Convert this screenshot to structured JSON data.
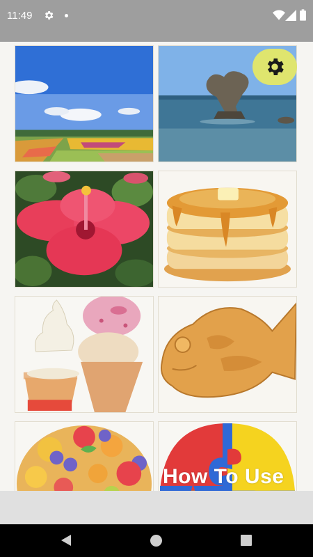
{
  "status_bar": {
    "time": "11:49",
    "icons": [
      "gear-icon",
      "notification-dot-icon",
      "wifi-icon",
      "cell-signal-icon",
      "battery-icon"
    ]
  },
  "settings_button": {
    "icon": "gear-icon"
  },
  "gallery": {
    "tiles": [
      {
        "name": "flower-field-photo"
      },
      {
        "name": "heart-rock-photo"
      },
      {
        "name": "hibiscus-photo"
      },
      {
        "name": "pancakes-illustration"
      },
      {
        "name": "ice-cream-illustration"
      },
      {
        "name": "taiyaki-illustration"
      },
      {
        "name": "fruit-tart-illustration"
      },
      {
        "name": "puzzle-how-to-use",
        "label": "How To Use"
      }
    ]
  },
  "nav_bar": {
    "icons": [
      "back-icon",
      "home-icon",
      "recents-icon"
    ]
  },
  "colors": {
    "status_bar": "#9e9e9e",
    "background": "#f6f5f2",
    "settings_button": "#dfe56e",
    "bottom_strip": "#e0e0e0",
    "nav_bar": "#000000"
  }
}
